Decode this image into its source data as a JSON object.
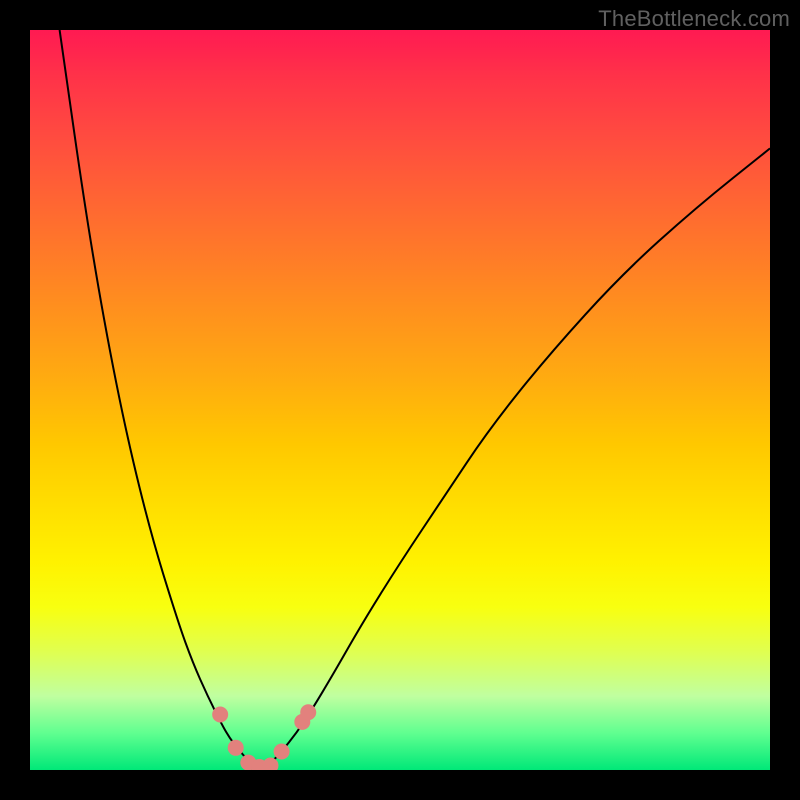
{
  "watermark": "TheBottleneck.com",
  "colors": {
    "frame_bg": "#000000",
    "marker": "#e2817d",
    "curve": "#000000"
  },
  "chart_data": {
    "type": "line",
    "title": "",
    "xlabel": "",
    "ylabel": "",
    "xlim": [
      0,
      100
    ],
    "ylim": [
      0,
      100
    ],
    "grid": false,
    "legend": false,
    "series": [
      {
        "name": "left_branch",
        "x": [
          4,
          8,
          12,
          16,
          20,
          22,
          24,
          26,
          27,
          28,
          29,
          30,
          31
        ],
        "values": [
          100,
          72,
          50,
          33,
          20,
          14.5,
          10,
          6,
          4.3,
          3,
          1.8,
          0.8,
          0.2
        ]
      },
      {
        "name": "right_branch",
        "x": [
          31,
          32,
          33,
          34,
          36,
          38,
          41,
          45,
          50,
          56,
          62,
          70,
          80,
          90,
          100
        ],
        "values": [
          0.2,
          0.6,
          1.4,
          2.5,
          5,
          8,
          13,
          20,
          28,
          37,
          46,
          56,
          67,
          76,
          84
        ]
      }
    ],
    "markers": [
      {
        "x": 25.7,
        "y": 7.5
      },
      {
        "x": 27.8,
        "y": 3.0
      },
      {
        "x": 29.5,
        "y": 1.0
      },
      {
        "x": 31.0,
        "y": 0.4
      },
      {
        "x": 32.5,
        "y": 0.6
      },
      {
        "x": 34.0,
        "y": 2.5
      },
      {
        "x": 36.8,
        "y": 6.5
      },
      {
        "x": 37.6,
        "y": 7.8
      }
    ]
  }
}
